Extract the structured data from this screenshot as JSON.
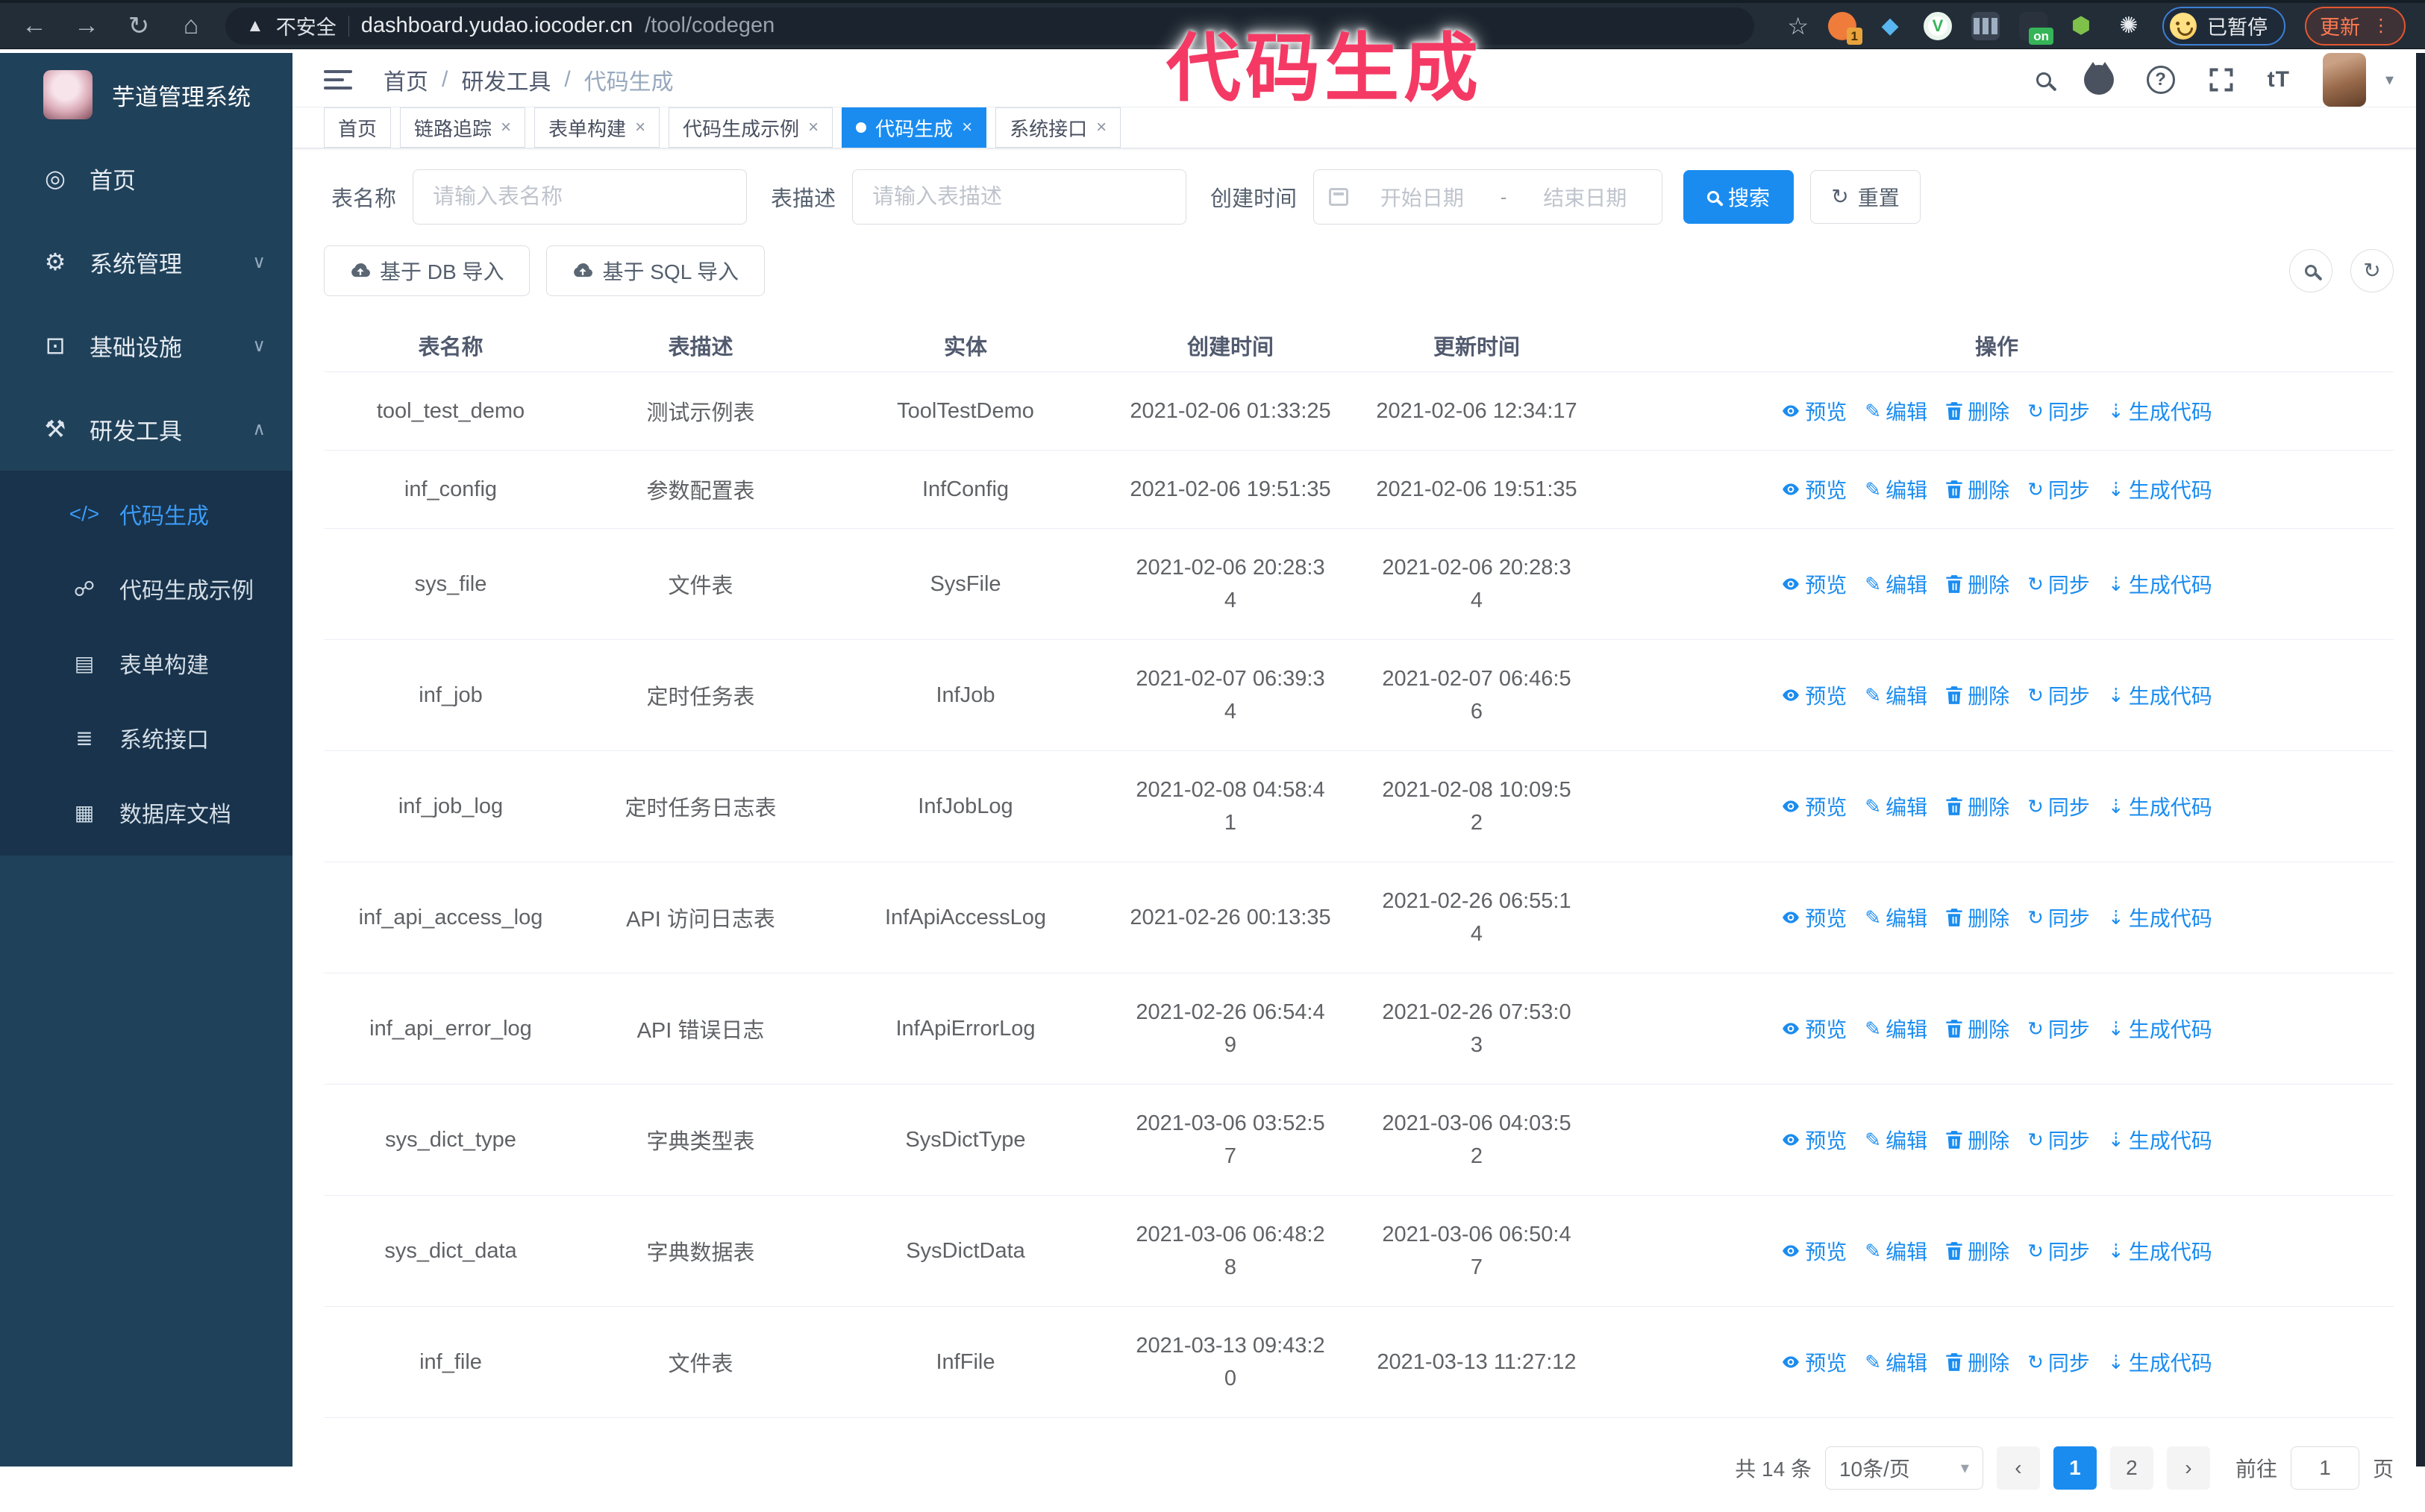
{
  "colors": {
    "accent": "#1a8cf0",
    "annotation": "#f43a64",
    "sidebar_bg": "#20415a",
    "submenu_bg": "#18334b"
  },
  "browser": {
    "security_label": "不安全",
    "url_host": "dashboard.yudao.iocoder.cn",
    "url_path": "/tool/codegen",
    "extension_badge_1": "1",
    "extension_badge_on": "on",
    "extension_shield_letter": "V",
    "profile_badge": "已暂停",
    "update_label": "更新"
  },
  "annotation": {
    "title": "代码生成"
  },
  "sidebar": {
    "logo_title": "芋道管理系统",
    "items": [
      {
        "label": "首页"
      },
      {
        "label": "系统管理"
      },
      {
        "label": "基础设施"
      },
      {
        "label": "研发工具"
      }
    ],
    "submenu": [
      {
        "label": "代码生成"
      },
      {
        "label": "代码生成示例"
      },
      {
        "label": "表单构建"
      },
      {
        "label": "系统接口"
      },
      {
        "label": "数据库文档"
      }
    ],
    "code_icon_text": "</>"
  },
  "header": {
    "breadcrumb": [
      "首页",
      "研发工具",
      "代码生成"
    ],
    "separator": "/",
    "font_size_icon_text": "tT"
  },
  "tabs": [
    {
      "label": "首页"
    },
    {
      "label": "链路追踪"
    },
    {
      "label": "表单构建"
    },
    {
      "label": "代码生成示例"
    },
    {
      "label": "代码生成"
    },
    {
      "label": "系统接口"
    }
  ],
  "filters": {
    "name_label": "表名称",
    "name_placeholder": "请输入表名称",
    "desc_label": "表描述",
    "desc_placeholder": "请输入表描述",
    "time_label": "创建时间",
    "start_placeholder": "开始日期",
    "range_separator": "-",
    "end_placeholder": "结束日期",
    "search_label": "搜索",
    "reset_label": "重置"
  },
  "toolbar": {
    "import_db_label": "基于 DB 导入",
    "import_sql_label": "基于 SQL 导入"
  },
  "table": {
    "columns": [
      "表名称",
      "表描述",
      "实体",
      "创建时间",
      "更新时间",
      "操作"
    ],
    "actions": [
      "预览",
      "编辑",
      "删除",
      "同步",
      "生成代码"
    ],
    "rows": [
      {
        "name": "tool_test_demo",
        "desc": "测试示例表",
        "entity": "ToolTestDemo",
        "created": "2021-02-06 01:33:25",
        "updated": "2021-02-06 12:34:17"
      },
      {
        "name": "inf_config",
        "desc": "参数配置表",
        "entity": "InfConfig",
        "created": "2021-02-06 19:51:35",
        "updated": "2021-02-06 19:51:35"
      },
      {
        "name": "sys_file",
        "desc": "文件表",
        "entity": "SysFile",
        "created": "2021-02-06 20:28:3\n4",
        "updated": "2021-02-06 20:28:3\n4"
      },
      {
        "name": "inf_job",
        "desc": "定时任务表",
        "entity": "InfJob",
        "created": "2021-02-07 06:39:3\n4",
        "updated": "2021-02-07 06:46:5\n6"
      },
      {
        "name": "inf_job_log",
        "desc": "定时任务日志表",
        "entity": "InfJobLog",
        "created": "2021-02-08 04:58:4\n1",
        "updated": "2021-02-08 10:09:5\n2"
      },
      {
        "name": "inf_api_access_log",
        "desc": "API 访问日志表",
        "entity": "InfApiAccessLog",
        "created": "2021-02-26 00:13:35",
        "updated": "2021-02-26 06:55:1\n4"
      },
      {
        "name": "inf_api_error_log",
        "desc": "API 错误日志",
        "entity": "InfApiErrorLog",
        "created": "2021-02-26 06:54:4\n9",
        "updated": "2021-02-26 07:53:0\n3"
      },
      {
        "name": "sys_dict_type",
        "desc": "字典类型表",
        "entity": "SysDictType",
        "created": "2021-03-06 03:52:5\n7",
        "updated": "2021-03-06 04:03:5\n2"
      },
      {
        "name": "sys_dict_data",
        "desc": "字典数据表",
        "entity": "SysDictData",
        "created": "2021-03-06 06:48:2\n8",
        "updated": "2021-03-06 06:50:4\n7"
      },
      {
        "name": "inf_file",
        "desc": "文件表",
        "entity": "InfFile",
        "created": "2021-03-13 09:43:2\n0",
        "updated": "2021-03-13 11:27:12"
      }
    ]
  },
  "pagination": {
    "total": "共 14 条",
    "page_size": "10条/页",
    "pages": [
      "1",
      "2"
    ],
    "goto_label": "前往",
    "goto_value": "1",
    "goto_suffix": "页"
  }
}
